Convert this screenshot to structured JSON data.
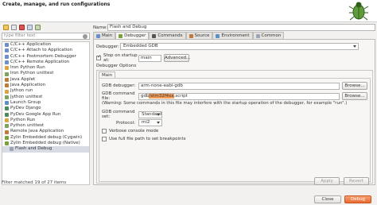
{
  "window": {
    "title": "Create, manage, and run configurations"
  },
  "toolbar": {
    "icons": [
      "new-config-icon",
      "duplicate-icon",
      "delete-icon",
      "collapse-icon",
      "filter-icon"
    ]
  },
  "filter": {
    "placeholder": "type filter text"
  },
  "tree": {
    "items": [
      {
        "label": "C/C++ Application",
        "color": "#6b8fc9",
        "child": false
      },
      {
        "label": "C/C++ Attach to Application",
        "color": "#6b8fc9",
        "child": false
      },
      {
        "label": "C/C++ Postmortem Debugger",
        "color": "#6b8fc9",
        "child": false
      },
      {
        "label": "C/C++ Remote Application",
        "color": "#6b8fc9",
        "child": false
      },
      {
        "label": "Iron Python Run",
        "color": "#d9a441",
        "child": false
      },
      {
        "label": "Iron Python unittest",
        "color": "#7da35c",
        "child": false
      },
      {
        "label": "Java Applet",
        "color": "#c07a3c",
        "child": false
      },
      {
        "label": "Java Application",
        "color": "#c07a3c",
        "child": false
      },
      {
        "label": "Jython run",
        "color": "#d9a441",
        "child": false
      },
      {
        "label": "Jython unittest",
        "color": "#7da35c",
        "child": false
      },
      {
        "label": "Launch Group",
        "color": "#5a8fc7",
        "child": false
      },
      {
        "label": "PyDev Django",
        "color": "#4c8c5c",
        "child": false
      },
      {
        "label": "PyDev Google App Run",
        "color": "#4c8c5c",
        "child": false
      },
      {
        "label": "Python Run",
        "color": "#d9a441",
        "child": false
      },
      {
        "label": "Python unittest",
        "color": "#7da35c",
        "child": false
      },
      {
        "label": "Remote Java Application",
        "color": "#c07a3c",
        "child": false
      },
      {
        "label": "Zylin Embedded debug (Cygwin)",
        "color": "#7aa23c",
        "child": false
      },
      {
        "label": "Zylin Embedded debug (Native)",
        "color": "#7aa23c",
        "child": false
      },
      {
        "label": "Flash and Debug",
        "color": "#9aa6b8",
        "child": true,
        "selected": true
      }
    ]
  },
  "status": {
    "filtered_text": "Filter matched 19 of 27 items"
  },
  "config": {
    "name_label": "Name:",
    "name_value": "Flash and Debug"
  },
  "tabs": [
    {
      "label": "Main",
      "icon": "main-tab-icon",
      "color": "#6b8fc9",
      "active": false
    },
    {
      "label": "Debugger",
      "icon": "debugger-tab-icon",
      "color": "#7aa23c",
      "active": true
    },
    {
      "label": "Commands",
      "icon": "commands-tab-icon",
      "color": "#555555",
      "active": false
    },
    {
      "label": "Source",
      "icon": "source-tab-icon",
      "color": "#c07a3c",
      "active": false
    },
    {
      "label": "Environment",
      "icon": "environment-tab-icon",
      "color": "#5a8fc7",
      "active": false
    },
    {
      "label": "Common",
      "icon": "common-tab-icon",
      "color": "#9aa6b8",
      "active": false
    }
  ],
  "debugger": {
    "debugger_label": "Debugger:",
    "debugger_value": "Embedded GDB",
    "stop_on_startup_label": "Stop on startup at:",
    "stop_on_startup_checked": true,
    "stop_on_startup_value": "main",
    "advanced_button": "Advanced...",
    "options_label": "Debugger Options",
    "main_subtab": "Main",
    "gdb_debugger_label": "GDB debugger:",
    "gdb_debugger_value": "arm-none-eabi-gdb",
    "browse_label": "Browse...",
    "gdb_command_file_label": "GDB command file:",
    "gdb_command_file_prefix": "gdb",
    "gdb_command_file_highlight": "/stm32f4xx",
    "gdb_command_file_suffix": ".script",
    "warning_text": "(Warning: Some commands in this file may interfere with the startup operation of the debugger, for example \"run\".)",
    "gdb_command_set_label": "GDB command set:",
    "gdb_command_set_value": "Standard",
    "protocol_label": "Protocol:",
    "protocol_value": "mi2",
    "verbose_label": "Verbose console mode",
    "verbose_checked": false,
    "full_path_label": "Use full file path to set breakpoints",
    "full_path_checked": false
  },
  "buttons": {
    "apply": "Apply",
    "revert": "Revert",
    "close": "Close",
    "debug": "Debug"
  }
}
